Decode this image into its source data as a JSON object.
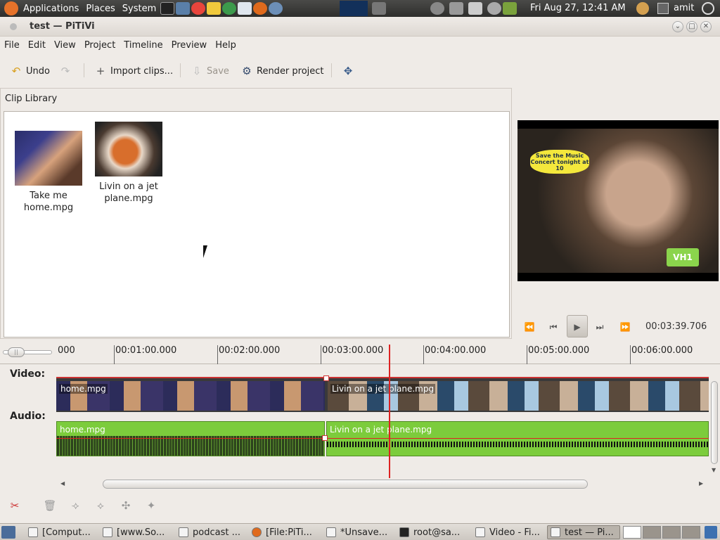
{
  "panel": {
    "menus": [
      "Applications",
      "Places",
      "System"
    ],
    "clock": "Fri Aug 27, 12:41 AM",
    "user": "amit"
  },
  "window": {
    "title": "test — PiTiVi",
    "controls": [
      "minimize-icon",
      "maximize-icon",
      "close-icon"
    ]
  },
  "menubar": {
    "file": "File",
    "edit": "Edit",
    "view": "View",
    "project": "Project",
    "timeline": "Timeline",
    "preview": "Preview",
    "help": "Help"
  },
  "toolbar": {
    "undo": "Undo",
    "import": "Import clips...",
    "save": "Save",
    "render": "Render project"
  },
  "library": {
    "title": "Clip Library",
    "clips": [
      {
        "name": "Take me home.mpg"
      },
      {
        "name": "Livin on a jet plane.mpg"
      }
    ]
  },
  "preview": {
    "badge": "Save the Music Concert tonight at 10",
    "logo": "VH1",
    "timecode": "00:03:39.706",
    "playhead_fraction": 0.335
  },
  "timeline": {
    "ticks": [
      "000",
      "00:01:00.000",
      "00:02:00.000",
      "00:03:00.000",
      "00:04:00.000",
      "00:05:00.000",
      "00:06:00.000"
    ],
    "video_label": "Video:",
    "audio_label": "Audio:",
    "video_clips": [
      "home.mpg",
      "Livin on a jet plane.mpg"
    ],
    "audio_clips": [
      "home.mpg",
      "Livin on a jet plane.mpg"
    ]
  },
  "taskbar": {
    "items": [
      "[Comput...",
      "[www.So...",
      "podcast ...",
      "[File:PiTi...",
      "*Unsave...",
      "root@sa...",
      "Video - Fi...",
      "test — Pi..."
    ]
  },
  "colors": {
    "accent": "#7ccc3c",
    "playhead": "#dd2222",
    "panel": "#3a3a38"
  }
}
